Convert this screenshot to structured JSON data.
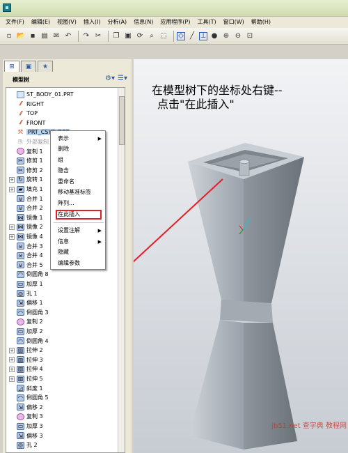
{
  "menu": [
    "文件(F)",
    "编辑(E)",
    "视图(V)",
    "插入(I)",
    "分析(A)",
    "信息(N)",
    "应用程序(P)",
    "工具(T)",
    "窗口(W)",
    "帮助(H)"
  ],
  "toolbar_icons": [
    "new-icon",
    "open-icon",
    "save-icon",
    "print-icon",
    "email-icon",
    "undo-icon",
    "redo-icon",
    "cut-icon",
    "copy-icon",
    "paste-icon",
    "regenerate-icon",
    "find-icon",
    "select-icon",
    "datum-plane-display-icon",
    "datum-axis-display-icon",
    "csys-display-icon",
    "shading-icon",
    "zoom-in-icon",
    "zoom-out-icon",
    "refit-icon"
  ],
  "tree": {
    "title": "模型树",
    "items": [
      {
        "label": "ST_BODY_01.PRT",
        "icon": "part-icon",
        "expandable": false
      },
      {
        "label": "RIGHT",
        "icon": "datum-plane-icon",
        "expandable": false
      },
      {
        "label": "TOP",
        "icon": "datum-plane-icon",
        "expandable": false
      },
      {
        "label": "FRONT",
        "icon": "datum-plane-icon",
        "expandable": false
      },
      {
        "label": "PRT_CSYS_DEF",
        "icon": "csys-icon",
        "expandable": false,
        "selected": true
      },
      {
        "label": "外部复制",
        "icon": "external-copy-icon",
        "expandable": false,
        "grey": true
      },
      {
        "label": "复制 1",
        "icon": "copy-feature-icon",
        "expandable": false
      },
      {
        "label": "修剪 1",
        "icon": "trim-icon",
        "expandable": false
      },
      {
        "label": "修剪 2",
        "icon": "trim-icon",
        "expandable": false
      },
      {
        "label": "旋转 1",
        "icon": "revolve-icon",
        "expandable": true
      },
      {
        "label": "填充 1",
        "icon": "fill-icon",
        "expandable": true
      },
      {
        "label": "合并 1",
        "icon": "merge-icon",
        "expandable": false
      },
      {
        "label": "合并 2",
        "icon": "merge-icon",
        "expandable": false
      },
      {
        "label": "镜像 1",
        "icon": "mirror-icon",
        "expandable": false
      },
      {
        "label": "镜像 2",
        "icon": "mirror-icon",
        "expandable": true
      },
      {
        "label": "镜像 4",
        "icon": "mirror-icon",
        "expandable": true
      },
      {
        "label": "合并 3",
        "icon": "merge-icon",
        "expandable": false
      },
      {
        "label": "合并 4",
        "icon": "merge-icon",
        "expandable": false
      },
      {
        "label": "合并 5",
        "icon": "merge-icon",
        "expandable": false
      },
      {
        "label": "倒圆角 8",
        "icon": "round-icon",
        "expandable": false
      },
      {
        "label": "加厚 1",
        "icon": "thicken-icon",
        "expandable": false
      },
      {
        "label": "孔 1",
        "icon": "hole-icon",
        "expandable": false
      },
      {
        "label": "偏移 1",
        "icon": "offset-icon",
        "expandable": false
      },
      {
        "label": "倒圆角 3",
        "icon": "round-icon",
        "expandable": false
      },
      {
        "label": "复制 2",
        "icon": "copy-feature-icon",
        "expandable": false
      },
      {
        "label": "加厚 2",
        "icon": "thicken-icon",
        "expandable": false
      },
      {
        "label": "倒圆角 4",
        "icon": "round-icon",
        "expandable": false
      },
      {
        "label": "拉伸 2",
        "icon": "extrude-icon",
        "expandable": true
      },
      {
        "label": "拉伸 3",
        "icon": "extrude-icon",
        "expandable": true
      },
      {
        "label": "拉伸 4",
        "icon": "extrude-icon",
        "expandable": true
      },
      {
        "label": "拉伸 5",
        "icon": "extrude-icon",
        "expandable": true
      },
      {
        "label": "斜度 1",
        "icon": "draft-icon",
        "expandable": false
      },
      {
        "label": "倒圆角 5",
        "icon": "round-icon",
        "expandable": false
      },
      {
        "label": "偏移 2",
        "icon": "offset-icon",
        "expandable": false
      },
      {
        "label": "复制 3",
        "icon": "copy-feature-icon",
        "expandable": false
      },
      {
        "label": "加厚 3",
        "icon": "thicken-icon",
        "expandable": false
      },
      {
        "label": "偏移 3",
        "icon": "offset-icon",
        "expandable": false
      },
      {
        "label": "孔 2",
        "icon": "hole-icon",
        "expandable": false
      }
    ]
  },
  "context_menu": {
    "items": [
      {
        "label": "表示",
        "submenu": true
      },
      {
        "label": "删除",
        "submenu": false
      },
      {
        "label": "组",
        "submenu": false
      },
      {
        "label": "隐含",
        "submenu": false
      },
      {
        "label": "重命名",
        "submenu": false
      },
      {
        "label": "移动基准标签",
        "submenu": false
      },
      {
        "label": "阵列...",
        "submenu": false
      },
      {
        "label": "在此插入",
        "submenu": false,
        "highlighted": true
      },
      {
        "label": "设置注解",
        "submenu": true
      },
      {
        "label": "信息",
        "submenu": true
      },
      {
        "label": "隐藏",
        "submenu": false
      },
      {
        "label": "编辑参数",
        "submenu": false
      }
    ]
  },
  "annotation": {
    "line1": "在模型树下的坐标处右键--",
    "line2": "点击\"在此插入\""
  },
  "watermark": "jb51.net 查字典 教程网",
  "colors": {
    "highlight_box": "#e21f26",
    "arrow": "#e21f26",
    "model_fill": "#a9b0b8"
  }
}
